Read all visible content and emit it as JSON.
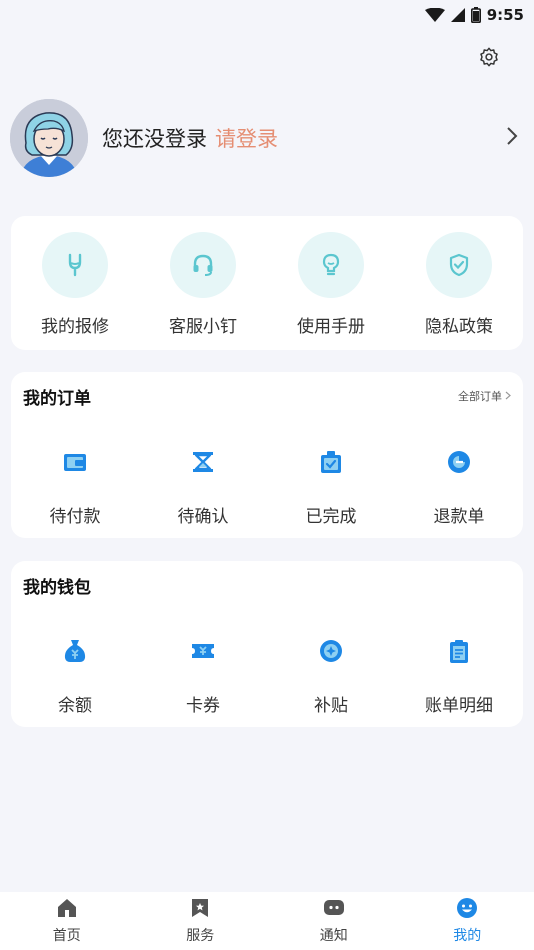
{
  "status_bar": {
    "time": "9:55",
    "icons": [
      "wifi-icon",
      "cell-signal-icon",
      "battery-icon"
    ]
  },
  "header": {
    "settings_icon": "gear-icon"
  },
  "profile": {
    "avatar_icon": "avatar",
    "login_prompt": "您还没登录",
    "login_link": "请登录",
    "chevron_icon": "chevron-right-icon"
  },
  "services": {
    "items": [
      {
        "label": "我的报修",
        "icon": "wrench-icon"
      },
      {
        "label": "客服小钉",
        "icon": "headset-icon"
      },
      {
        "label": "使用手册",
        "icon": "lightbulb-icon"
      },
      {
        "label": "隐私政策",
        "icon": "shield-check-icon"
      }
    ]
  },
  "orders": {
    "title": "我的订单",
    "more_label": "全部订单",
    "items": [
      {
        "label": "待付款",
        "icon": "wallet-icon"
      },
      {
        "label": "待确认",
        "icon": "hourglass-icon"
      },
      {
        "label": "已完成",
        "icon": "clipboard-check-icon"
      },
      {
        "label": "退款单",
        "icon": "refund-icon"
      }
    ]
  },
  "wallet": {
    "title": "我的钱包",
    "items": [
      {
        "label": "余额",
        "icon": "money-bag-icon"
      },
      {
        "label": "卡券",
        "icon": "ticket-icon"
      },
      {
        "label": "补贴",
        "icon": "subsidy-icon"
      },
      {
        "label": "账单明细",
        "icon": "bill-icon"
      }
    ]
  },
  "bottom_nav": {
    "items": [
      {
        "label": "首页",
        "icon": "home-icon"
      },
      {
        "label": "服务",
        "icon": "bookmark-icon"
      },
      {
        "label": "通知",
        "icon": "message-icon"
      },
      {
        "label": "我的",
        "icon": "smile-icon",
        "active": true
      }
    ]
  },
  "colors": {
    "accent": "#1E88E5",
    "login_link": "#E58E73",
    "teal": "#5BC6CF",
    "icon_circle_bg": "#E6F6F7",
    "background": "#F4F5FA"
  }
}
